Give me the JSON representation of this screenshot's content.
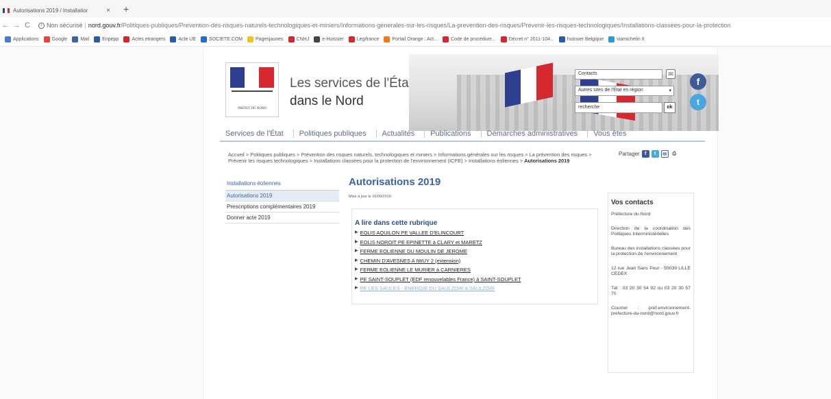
{
  "browser": {
    "tab": {
      "title": "Autorisations 2019 / Installatior",
      "close": "×"
    },
    "new_tab": "+",
    "nav": {
      "back": "←",
      "forward": "→",
      "reload": "C"
    },
    "url": {
      "security": "Non sécurisé",
      "separator": "|",
      "host": "nord.gouv.fr",
      "path": "/Politiques-publiques/Prevention-des-risques-naturels-technologiques-et-miniers/Informations-generales-sur-les-risques/La-prevention-des-risques/Prevenir-les-risques-technologiques/Installations-classees-pour-la-protection"
    },
    "bookmarks": [
      {
        "label": "Applications",
        "color": "#4a7bd0"
      },
      {
        "label": "Google",
        "color": "#e8453c"
      },
      {
        "label": "Mail",
        "color": "#3a64a8"
      },
      {
        "label": "Enpepp",
        "color": "#2a5da8"
      },
      {
        "label": "Actes etrangers",
        "color": "#d5282f"
      },
      {
        "label": "Acte UE",
        "color": "#2a5da8"
      },
      {
        "label": "SOCIETE.COM",
        "color": "#2a6ad0"
      },
      {
        "label": "Pagesjaunes",
        "color": "#f0c419"
      },
      {
        "label": "CNHJ",
        "color": "#d5282f"
      },
      {
        "label": "e-Huissier",
        "color": "#444444"
      },
      {
        "label": "Legifrance",
        "color": "#d5282f"
      },
      {
        "label": "Portail Orange : Act...",
        "color": "#f07a1a"
      },
      {
        "label": "Code de procédure...",
        "color": "#d5282f"
      },
      {
        "label": "Décret n° 2011-104...",
        "color": "#d5282f"
      },
      {
        "label": "huissier Belgique",
        "color": "#2a5da8"
      },
      {
        "label": "viamichelin It",
        "color": "#2a9ad0"
      }
    ]
  },
  "site": {
    "logo_text": "PRÉFET DU NORD",
    "title_line1": "Les services de l'État",
    "title_line2": "dans le Nord",
    "contacts_label": "Contacts",
    "mail_icon": "✉",
    "select_value": "Autres sites de l'État en région",
    "select_arrow": "▾",
    "search_value": "recherche",
    "ok_label": "ok",
    "facebook": "f",
    "twitter": "t"
  },
  "nav": [
    "Services de l'État",
    "Politiques publiques",
    "Actualités",
    "Publications",
    "Démarches administratives",
    "Vous êtes"
  ],
  "breadcrumb": {
    "trail": "Accueil > Politiques publiques > Prévention des risques naturels, technologiques et miniers > Informations générales sur les risques > La prévention des risques > Prévenir les risques technologiques > Installations classées pour la protection de l'environnement (ICPE) > Installations éoliennes > ",
    "current": "Autorisations 2019"
  },
  "share": {
    "label": "Partager",
    "facebook": "f",
    "twitter": "t",
    "mail": "✉",
    "print": "⎙"
  },
  "sidebar": {
    "heading": "Installations éoliennes",
    "items": [
      {
        "label": "Autorisations 2019"
      },
      {
        "label": "Prescriptions complémentaires 2019"
      },
      {
        "label": "Donner acte 2019"
      }
    ]
  },
  "main": {
    "heading": "Autorisations 2019",
    "updated": "Mise à jour le 16/09/2019",
    "rubrique_title": "A lire dans cette rubrique",
    "links": [
      "EOLIS AQUILON PE VALLEE D'ELINCOURT",
      "EOLIS NOROIT PE EPINETTE à CLARY et MARETZ",
      "FERME EOLIENNE DU MOULIN DE JEROME",
      "CHEMIN D'AVESNES A IWUY 2 (extension)",
      "FERME EOLIENNE LE MURIER à CARNIERES",
      "PE SAINT-SOUPLET (EDF renouvelables France) à SAINT-SOUPLET",
      "PE LES SAULES - ENERGIE DU SAULZOIR à SAULZOIR"
    ]
  },
  "contacts": {
    "title": "Vos contacts",
    "lines": [
      "Préfecture du Nord",
      "Direction de la coordination des Politiques Interministérielles",
      "Bureau des installations classées pour la protection de l'environnement",
      "12 rue Jean Sans Peur - 59039 LILLE CEDEX",
      "Tél : 03 20 30 54 92 ou 03 20 30 57 70",
      "Courriel : pref-environnement-prefecture-du-nord@nord.gouv.fr"
    ]
  }
}
